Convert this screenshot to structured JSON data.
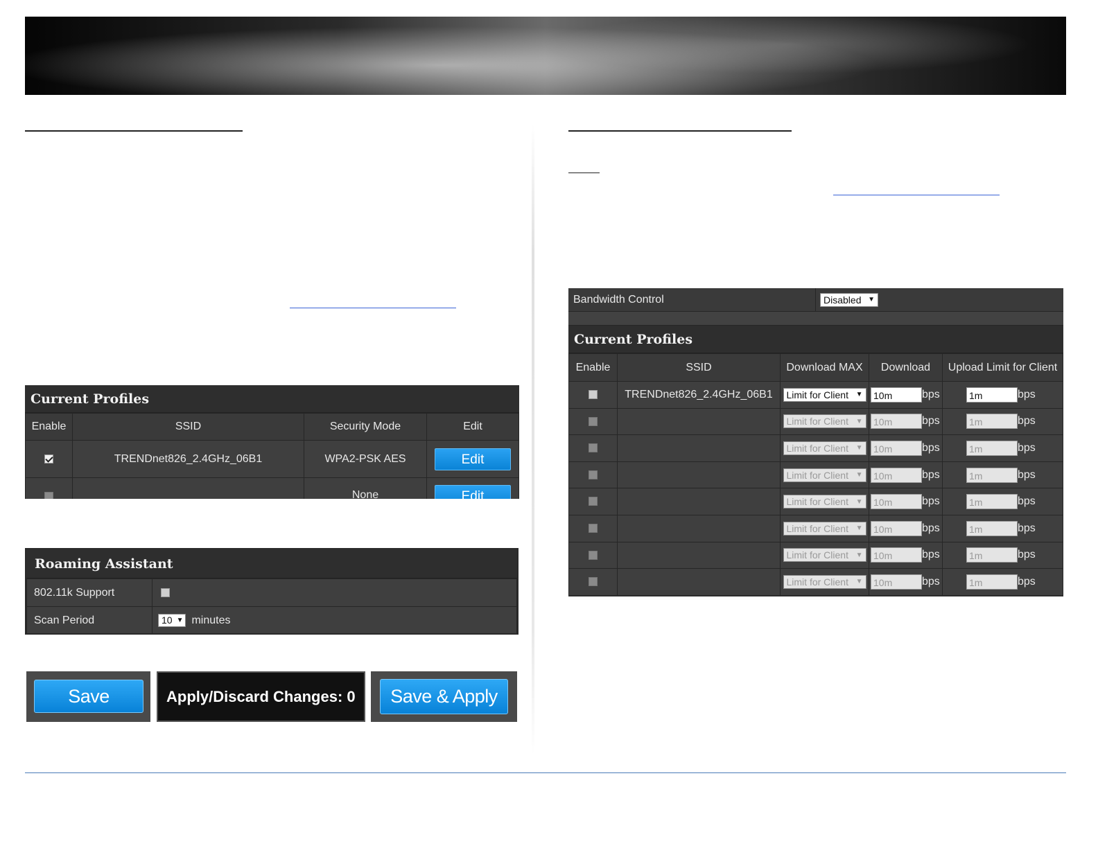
{
  "left_profiles": {
    "title": "Current Profiles",
    "headers": [
      "Enable",
      "SSID",
      "Security Mode",
      "Edit"
    ],
    "rows": [
      {
        "enabled": true,
        "ssid": "TRENDnet826_2.4GHz_06B1",
        "security": "WPA2-PSK AES",
        "edit": "Edit"
      },
      {
        "enabled": false,
        "ssid": "",
        "security": "None",
        "edit": "Edit"
      }
    ]
  },
  "roaming": {
    "title": "Roaming Assistant",
    "support_label": "802.11k Support",
    "scan_label": "Scan Period",
    "scan_value": "10",
    "scan_unit": "minutes"
  },
  "actions": {
    "save": "Save",
    "apply_discard": "Apply/Discard Changes: 0",
    "save_apply": "Save & Apply"
  },
  "bandwidth": {
    "label": "Bandwidth Control",
    "value": "Disabled"
  },
  "right_profiles": {
    "title": "Current Profiles",
    "headers": [
      "Enable",
      "SSID",
      "Download MAX",
      "Download",
      "Upload Limit for Client"
    ],
    "unit": "bps",
    "rows": [
      {
        "ssid": "TRENDnet826_2.4GHz_06B1",
        "mode": "Limit for Client",
        "download": "10m",
        "upload": "1m",
        "active": true
      },
      {
        "ssid": "",
        "mode": "Limit for Client",
        "download": "10m",
        "upload": "1m",
        "active": false
      },
      {
        "ssid": "",
        "mode": "Limit for Client",
        "download": "10m",
        "upload": "1m",
        "active": false
      },
      {
        "ssid": "",
        "mode": "Limit for Client",
        "download": "10m",
        "upload": "1m",
        "active": false
      },
      {
        "ssid": "",
        "mode": "Limit for Client",
        "download": "10m",
        "upload": "1m",
        "active": false
      },
      {
        "ssid": "",
        "mode": "Limit for Client",
        "download": "10m",
        "upload": "1m",
        "active": false
      },
      {
        "ssid": "",
        "mode": "Limit for Client",
        "download": "10m",
        "upload": "1m",
        "active": false
      },
      {
        "ssid": "",
        "mode": "Limit for Client",
        "download": "10m",
        "upload": "1m",
        "active": false
      }
    ]
  }
}
